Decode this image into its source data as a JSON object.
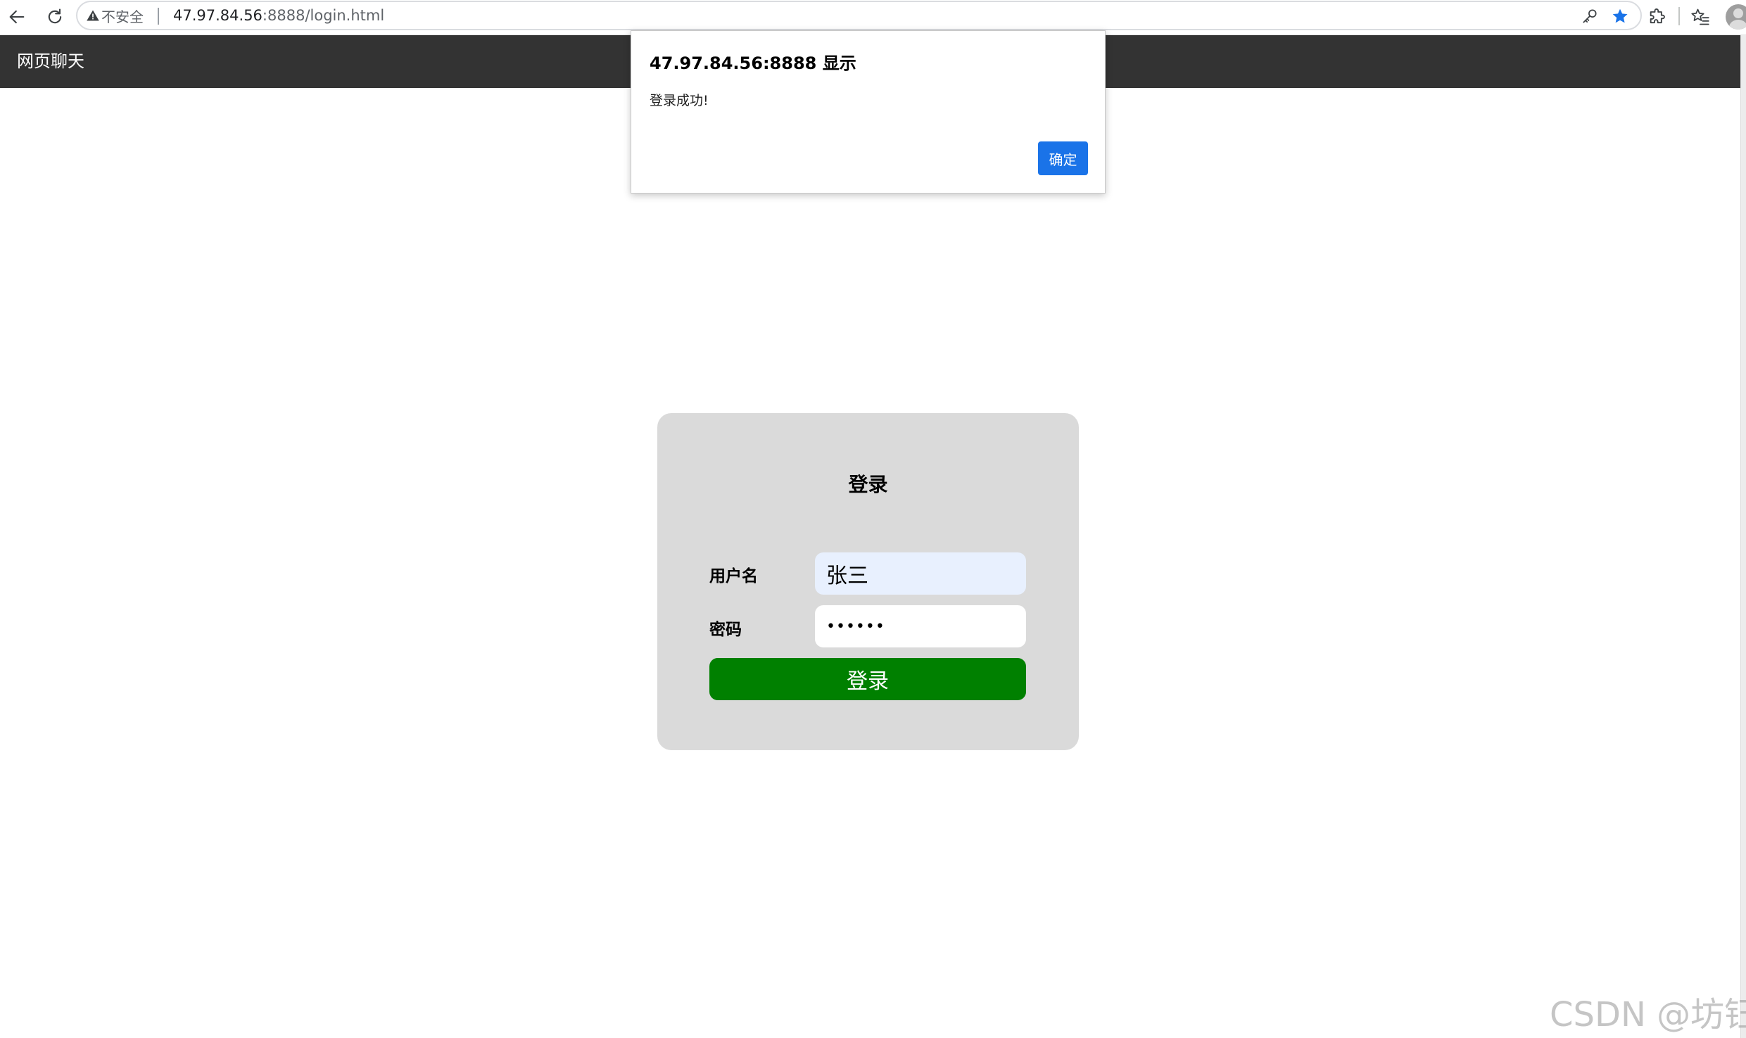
{
  "browser": {
    "security_label": "不安全",
    "url_host": "47.97.84.56",
    "url_rest": ":8888/login.html",
    "icons": {
      "back": "arrow-left-icon",
      "reload": "reload-icon",
      "warning": "warning-triangle-icon",
      "password": "key-icon",
      "bookmark": "star-icon",
      "extensions": "puzzle-icon",
      "favorites": "star-list-icon",
      "profile": "avatar"
    },
    "bookmark_color": "#1a73e8"
  },
  "page": {
    "nav_title": "网页聊天",
    "nav_color": "#333333"
  },
  "login": {
    "title": "登录",
    "username_label": "用户名",
    "username_value": "张三",
    "password_label": "密码",
    "password_value": "••••••",
    "submit_label": "登录",
    "card_color": "#dadada",
    "button_color": "#008000"
  },
  "dialog": {
    "title": "47.97.84.56:8888 显示",
    "message": "登录成功!",
    "ok_label": "确定",
    "ok_color": "#1a73e8"
  },
  "watermark": "CSDN @坊钰"
}
